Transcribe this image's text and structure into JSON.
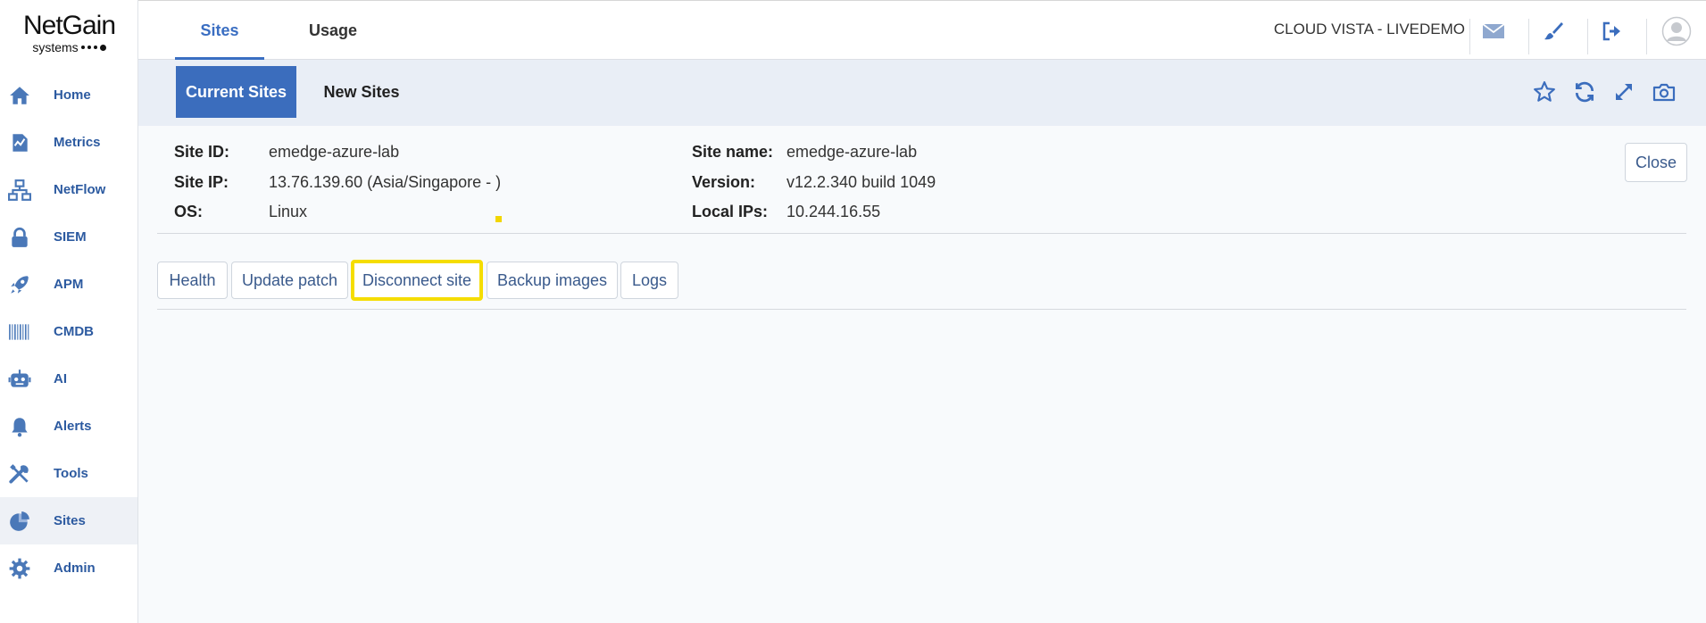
{
  "brand": {
    "name": "NetGain",
    "sub": "systems"
  },
  "sidebar": {
    "items": [
      {
        "label": "Home",
        "icon": "home-icon"
      },
      {
        "label": "Metrics",
        "icon": "metrics-icon"
      },
      {
        "label": "NetFlow",
        "icon": "netflow-icon"
      },
      {
        "label": "SIEM",
        "icon": "lock-icon"
      },
      {
        "label": "APM",
        "icon": "rocket-icon"
      },
      {
        "label": "CMDB",
        "icon": "barcode-icon"
      },
      {
        "label": "AI",
        "icon": "robot-icon"
      },
      {
        "label": "Alerts",
        "icon": "bell-icon"
      },
      {
        "label": "Tools",
        "icon": "tools-icon"
      },
      {
        "label": "Sites",
        "icon": "sites-icon"
      },
      {
        "label": "Admin",
        "icon": "gear-icon"
      }
    ],
    "active": "Sites"
  },
  "header": {
    "tabs": [
      {
        "label": "Sites"
      },
      {
        "label": "Usage"
      }
    ],
    "active_tab": "Sites",
    "org": "CLOUD VISTA - LIVEDEMO",
    "icons": [
      "mail-icon",
      "brush-icon",
      "logout-icon",
      "user-avatar-icon"
    ]
  },
  "subheader": {
    "tabs": [
      {
        "label": "Current Sites"
      },
      {
        "label": "New Sites"
      }
    ],
    "active_tab": "Current Sites",
    "icons": [
      "star-icon",
      "refresh-icon",
      "expand-icon",
      "camera-icon"
    ]
  },
  "site": {
    "id_label": "Site ID:",
    "id": "emedge-azure-lab",
    "ip_label": "Site IP:",
    "ip": "13.76.139.60 (Asia/Singapore - )",
    "os_label": "OS:",
    "os": "Linux",
    "name_label": "Site name:",
    "name": "emedge-azure-lab",
    "version_label": "Version:",
    "version": "v12.2.340 build 1049",
    "local_ips_label": "Local IPs:",
    "local_ips": "10.244.16.55"
  },
  "close_label": "Close",
  "actions": [
    {
      "label": "Health"
    },
    {
      "label": "Update patch"
    },
    {
      "label": "Disconnect site",
      "highlighted": true
    },
    {
      "label": "Backup images"
    },
    {
      "label": "Logs"
    }
  ],
  "colors": {
    "accent": "#3b6dbd",
    "nav_text": "#2c5aa0",
    "highlight": "#f5dd00",
    "subbar_bg": "#e9eef6"
  }
}
